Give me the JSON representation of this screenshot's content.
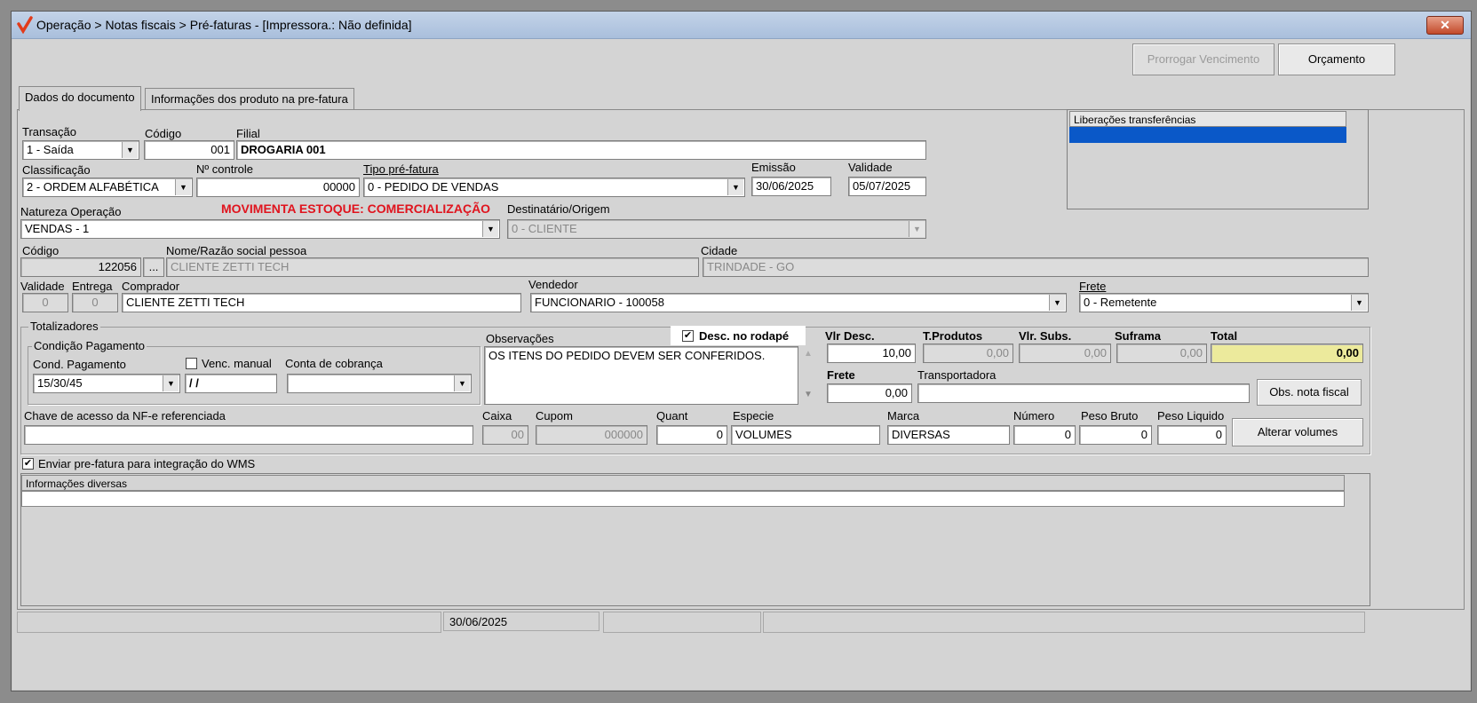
{
  "window": {
    "title": "Operação > Notas fiscais > Pré-faturas - [Impressora.: Não definida]",
    "close": "✕"
  },
  "toolbar": {
    "prorrogar": "Prorrogar Vencimento",
    "orcamento": "Orçamento"
  },
  "tabs": [
    "Dados do documento",
    "Informações dos produto na pre-fatura"
  ],
  "doc": {
    "transacao_label": "Transação",
    "transacao": "1 - Saída",
    "codigo_label": "Código",
    "codigo": "001",
    "filial_label": "Filial",
    "filial": "DROGARIA 001",
    "classificacao_label": "Classificação",
    "classificacao": "2 - ORDEM ALFABÉTICA",
    "controle_label": "Nº controle",
    "controle": "00000",
    "tipo_label": "Tipo pré-fatura",
    "tipo": "0 - PEDIDO DE VENDAS",
    "emissao_label": "Emissão",
    "emissao": "30/06/2025",
    "validade_label": "Validade",
    "validade": "05/07/2025",
    "natureza_label": "Natureza  Operação",
    "natureza": "VENDAS - 1",
    "movimenta": "MOVIMENTA ESTOQUE: COMERCIALIZAÇÃO",
    "destinatario_label": "Destinatário/Origem",
    "destinatario": "0 - CLIENTE",
    "cod_pessoa_label": "Código",
    "cod_pessoa": "122056",
    "ellipsis": "...",
    "nome_label": "Nome/Razão social pessoa",
    "nome": "CLIENTE ZETTI TECH",
    "cidade_label": "Cidade",
    "cidade": "TRINDADE - GO",
    "validade2_label": "Validade",
    "validade2": "0",
    "entrega_label": "Entrega",
    "entrega": "0",
    "comprador_label": "Comprador",
    "comprador": "CLIENTE ZETTI TECH",
    "vendedor_label": "Vendedor",
    "vendedor": "FUNCIONARIO - 100058",
    "frete_label": "Frete",
    "frete": "0 - Remetente"
  },
  "liberacoes": {
    "header": "Liberações transferências"
  },
  "totalizadores": {
    "label": "Totalizadores",
    "condicao_label": "Condição Pagamento",
    "cond_pag_label": "Cond. Pagamento",
    "cond_pag": "15/30/45",
    "venc_manual_label": "Venc. manual",
    "venc_manual": "/ /",
    "conta_label": "Conta de cobrança",
    "conta": "",
    "obs_label": "Observações",
    "obs": "OS ITENS DO PEDIDO DEVEM SER CONFERIDOS.",
    "desc_rodape_label": "Desc. no rodapé",
    "vlr_desc_label": "Vlr Desc.",
    "vlr_desc": "10,00",
    "tprod_label": "T.Produtos",
    "tprod": "0,00",
    "vlrsubs_label": "Vlr. Subs.",
    "vlrsubs": "0,00",
    "suframa_label": "Suframa",
    "suframa": "0,00",
    "total_label": "Total",
    "total": "0,00",
    "frete_label": "Frete",
    "frete": "0,00",
    "transp_label": "Transportadora",
    "transp": "",
    "obs_nf": "Obs. nota fiscal",
    "chave_label": "Chave de acesso da NF-e referenciada",
    "chave": "",
    "caixa_label": "Caixa",
    "caixa": "00",
    "cupom_label": "Cupom",
    "cupom": "000000",
    "quant_label": "Quant",
    "quant": "0",
    "especie_label": "Especie",
    "especie": "VOLUMES",
    "marca_label": "Marca",
    "marca": "DIVERSAS",
    "numero_label": "Número",
    "numero": "0",
    "pbruto_label": "Peso Bruto",
    "pbruto": "0",
    "pliquido_label": "Peso Liquido",
    "pliquido": "0",
    "alterar": "Alterar volumes"
  },
  "wms_label": "Enviar pre-fatura para integração do WMS",
  "info_label": "Informações diversas",
  "status": {
    "date": "30/06/2025"
  }
}
